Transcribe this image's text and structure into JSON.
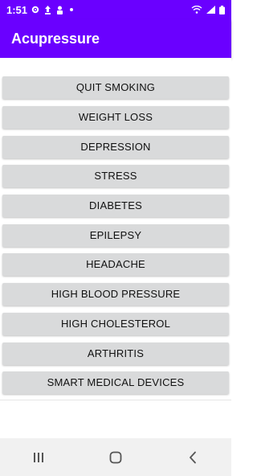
{
  "status_bar": {
    "time": "1:51",
    "icons_left": [
      "gear-icon",
      "notification-icon",
      "notification-icon",
      "dot-icon"
    ],
    "icons_right": [
      "wifi-icon",
      "signal-icon",
      "battery-icon"
    ]
  },
  "app_bar": {
    "title": "Acupressure",
    "color": "#6a00ff"
  },
  "menu": [
    {
      "label": "QUIT SMOKING"
    },
    {
      "label": "WEIGHT LOSS"
    },
    {
      "label": "DEPRESSION"
    },
    {
      "label": "STRESS"
    },
    {
      "label": "DIABETES"
    },
    {
      "label": "EPILEPSY"
    },
    {
      "label": "HEADACHE"
    },
    {
      "label": "HIGH BLOOD PRESSURE"
    },
    {
      "label": "HIGH CHOLESTEROL"
    },
    {
      "label": "ARTHRITIS"
    },
    {
      "label": "SMART MEDICAL DEVICES"
    }
  ],
  "nav_bar": {
    "buttons": [
      "recent-apps-icon",
      "home-icon",
      "back-icon"
    ]
  }
}
